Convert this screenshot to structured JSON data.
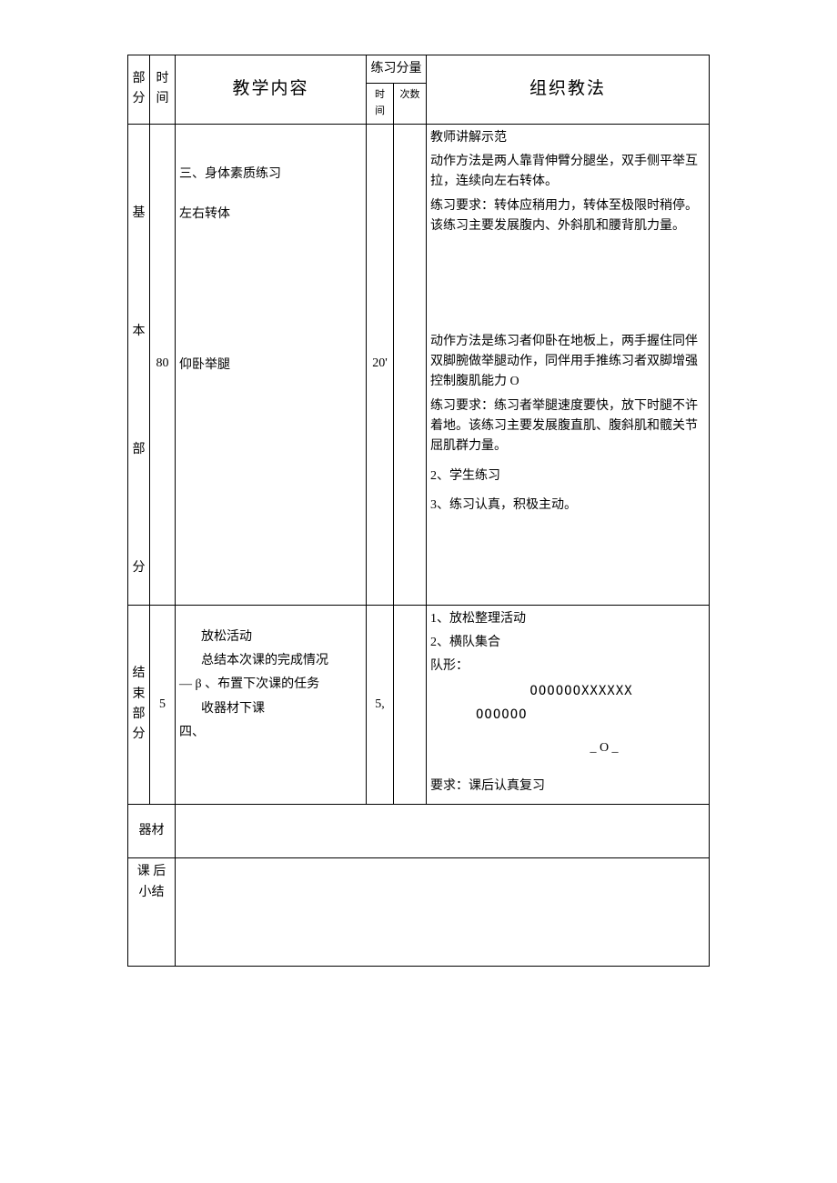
{
  "headers": {
    "part": [
      "部",
      "分"
    ],
    "time": [
      "时",
      "间"
    ],
    "content": "教学内容",
    "practice": "练习分量",
    "sub_time": "时间",
    "count": "次数",
    "method": "组织教法"
  },
  "rows": {
    "basic": {
      "part_label": [
        "基",
        "本",
        "部",
        "分"
      ],
      "time": "80",
      "sub_time": "20'",
      "content": {
        "section_title": "三、身体素质练习",
        "item1": "左右转体",
        "item2": "仰卧举腿"
      },
      "method": {
        "block1": {
          "l1": "教师讲解示范",
          "l2": "动作方法是两人靠背伸臂分腿坐，双手侧平举互拉，连续向左右转体。",
          "l3": "练习要求：转体应稍用力，转体至极限时稍停。该练习主要发展腹内、外斜肌和腰背肌力量。"
        },
        "block2": {
          "l1": "动作方法是练习者仰卧在地板上，两手握住同伴双脚腕做举腿动作，同伴用手推练习者双脚增强控制腹肌能力 O",
          "l2": "练习要求：练习者举腿速度要快，放下时腿不许着地。该练习主要发展腹直肌、腹斜肌和髋关节屈肌群力量。",
          "l3": "2、学生练习",
          "l4": "3、练习认真，积极主动。"
        }
      }
    },
    "end": {
      "part_label": [
        "结 束",
        "部 分"
      ],
      "time": "5",
      "sub_time": "5,",
      "content": {
        "c1": "放松活动",
        "c2": "总结本次课的完成情况",
        "c3_prefix": "— β 、布置下次课的任务",
        "c4": "收器材下课",
        "c5": "四、"
      },
      "method": {
        "l1": "1、放松整理活动",
        "l2": "2、横队集合",
        "l3": "队形：",
        "diag1": "OOOOOOXXXXXX",
        "diag2": "OOOOOO",
        "diag3": "_ O _",
        "l4": "要求：课后认真复习"
      }
    },
    "equipment": {
      "label": "器材"
    },
    "summary": {
      "label": [
        "课 后",
        "小结"
      ]
    }
  }
}
